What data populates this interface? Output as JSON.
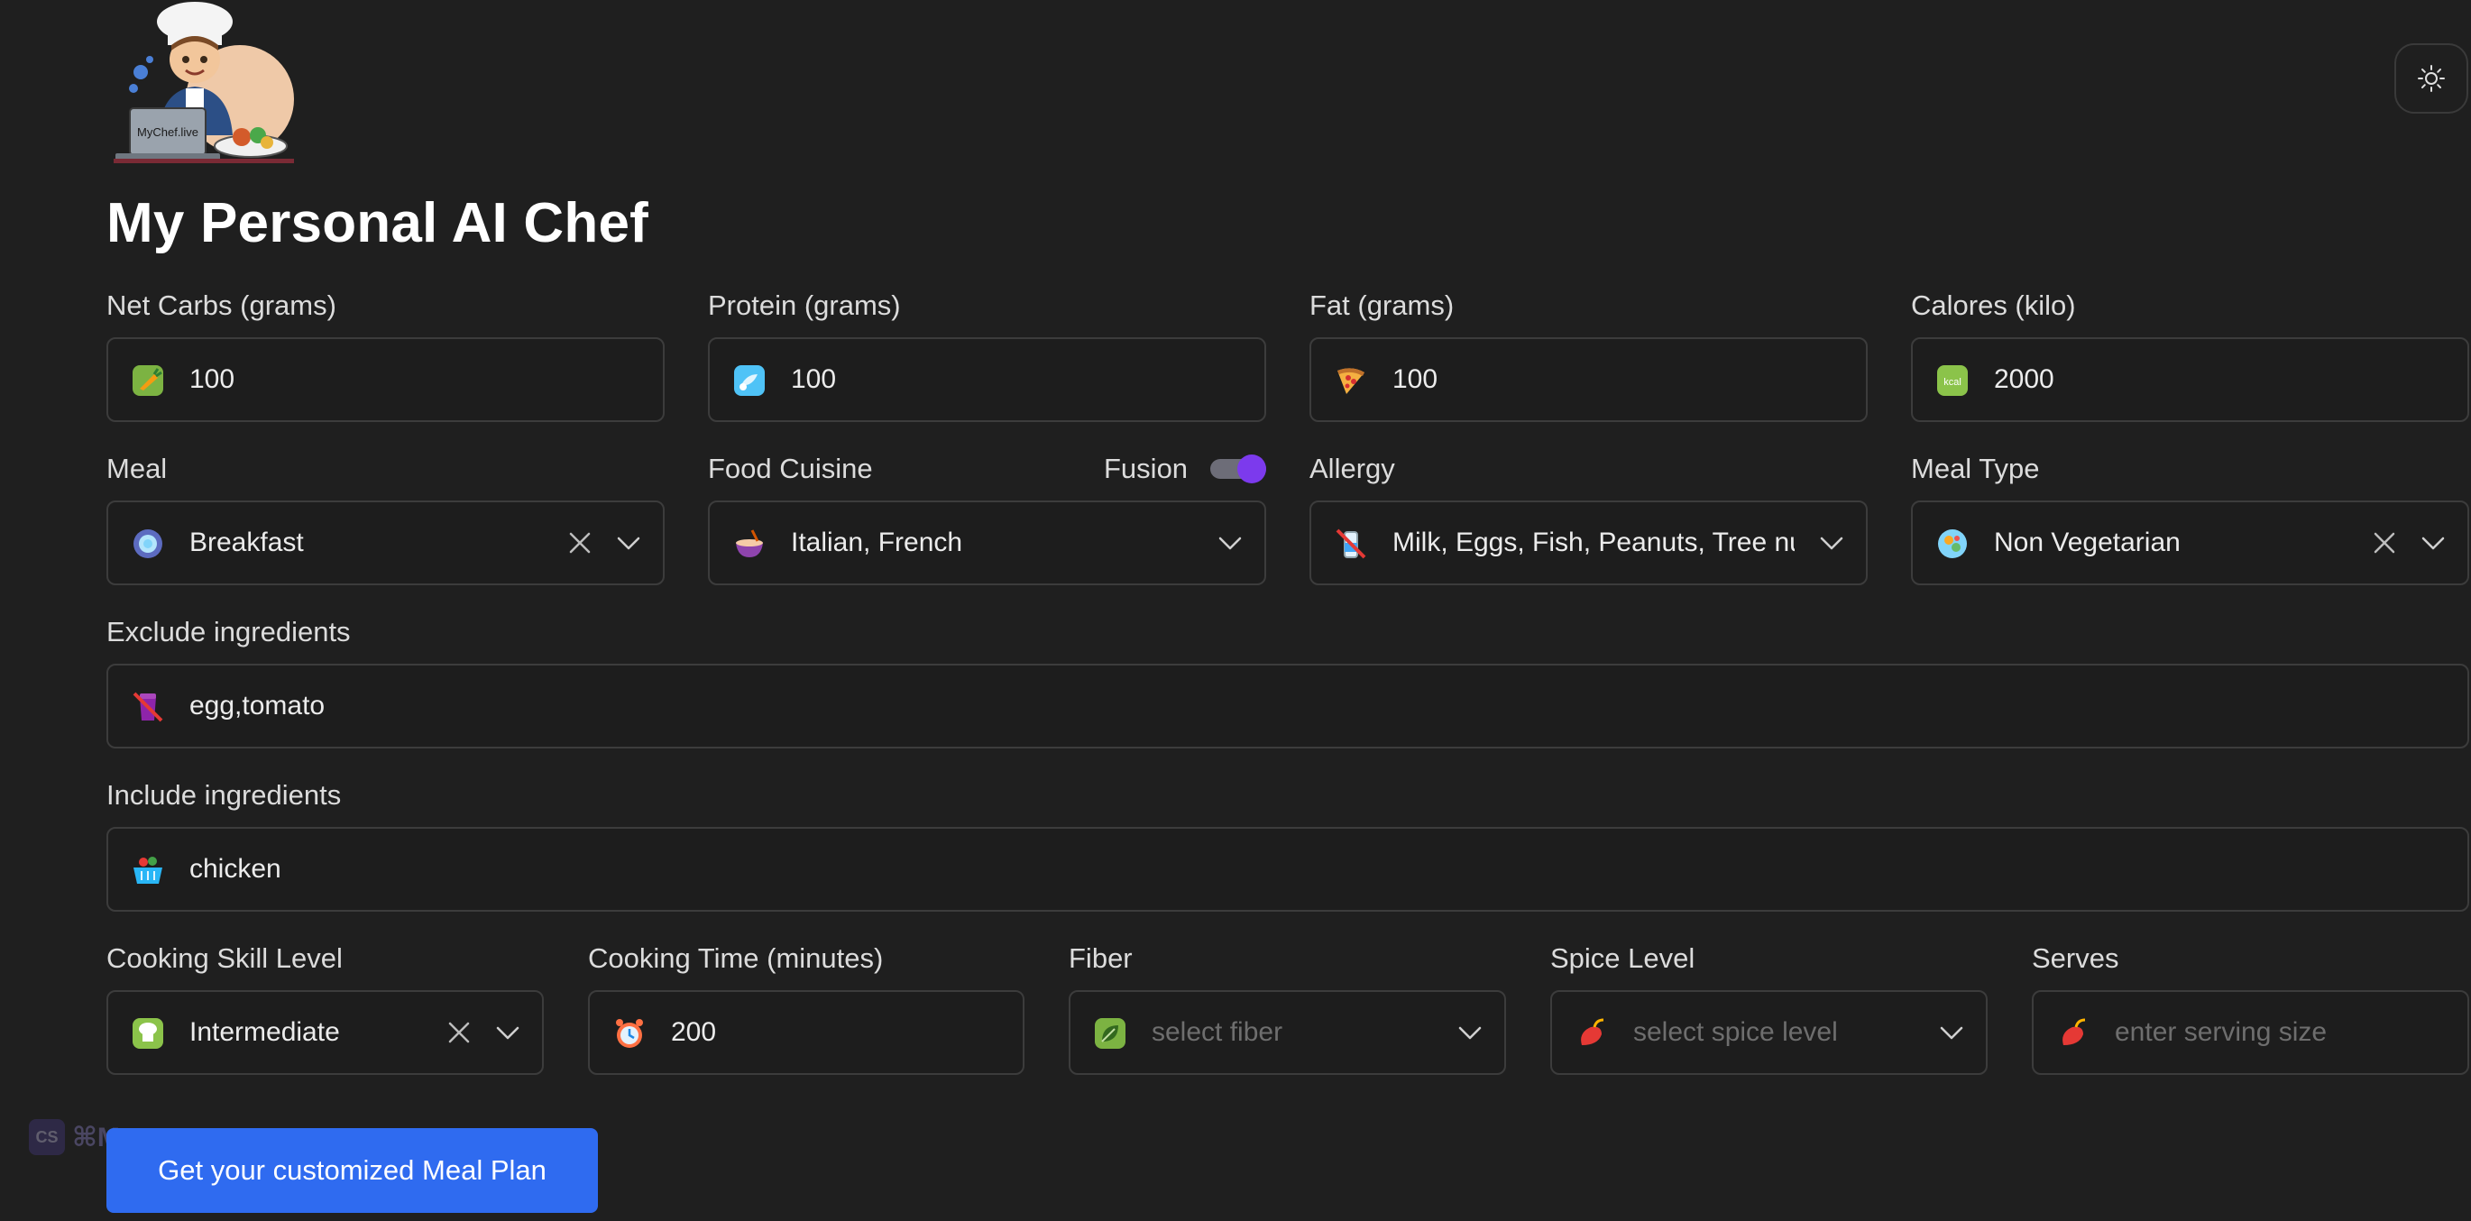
{
  "header": {
    "logo_text": "MyChef.live",
    "title": "My Personal AI Chef",
    "theme_toggle_icon": "sun-icon"
  },
  "macros": [
    {
      "label": "Net Carbs (grams)",
      "value": "100",
      "icon": "carrot-icon"
    },
    {
      "label": "Protein (grams)",
      "value": "100",
      "icon": "protein-icon"
    },
    {
      "label": "Fat (grams)",
      "value": "100",
      "icon": "pizza-icon"
    },
    {
      "label": "Calores (kilo)",
      "value": "2000",
      "icon": "kcal-icon"
    }
  ],
  "meal": {
    "label": "Meal",
    "value": "Breakfast",
    "icon": "meal-icon"
  },
  "cuisine": {
    "label": "Food Cuisine",
    "value": "Italian, French",
    "icon": "bowl-icon",
    "fusion_label": "Fusion",
    "fusion_on": true
  },
  "allergy": {
    "label": "Allergy",
    "value": "Milk, Eggs, Fish, Peanuts, Tree nu",
    "icon": "no-milk-icon"
  },
  "meal_type": {
    "label": "Meal Type",
    "value": "Non Vegetarian",
    "icon": "meal-type-icon"
  },
  "exclude": {
    "label": "Exclude ingredients",
    "value": "egg,tomato",
    "icon": "exclude-icon"
  },
  "include": {
    "label": "Include ingredients",
    "value": "chicken",
    "icon": "basket-icon"
  },
  "skill": {
    "label": "Cooking Skill Level",
    "value": "Intermediate",
    "icon": "chef-skill-icon"
  },
  "time": {
    "label": "Cooking Time (minutes)",
    "value": "200",
    "icon": "alarm-clock-icon"
  },
  "fiber": {
    "label": "Fiber",
    "placeholder": "select fiber",
    "icon": "leaf-icon"
  },
  "spice": {
    "label": "Spice Level",
    "placeholder": "select spice level",
    "icon": "chili-icon"
  },
  "serves": {
    "label": "Serves",
    "placeholder": "enter serving size",
    "icon": "chili-icon"
  },
  "submit_label": "Get your customized Meal Plan",
  "badge": {
    "box": "CS",
    "key": "⌘M"
  },
  "colors": {
    "background": "#1f1f1f",
    "accent_button": "#2f6bf0",
    "toggle_knob": "#7c3aed",
    "field_border": "#3c3c3c"
  }
}
